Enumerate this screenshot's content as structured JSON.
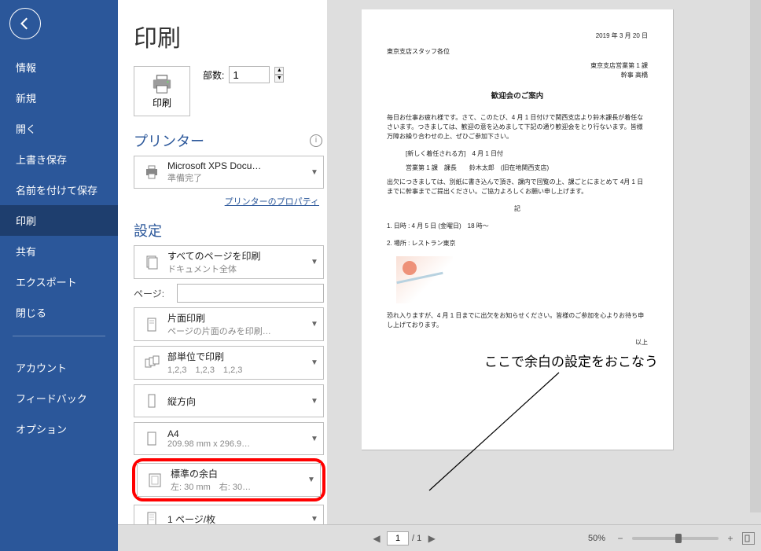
{
  "page_title": "印刷",
  "sidebar": {
    "items": [
      "情報",
      "新規",
      "開く",
      "上書き保存",
      "名前を付けて保存",
      "印刷",
      "共有",
      "エクスポート",
      "閉じる"
    ],
    "bottom_items": [
      "アカウント",
      "フィードバック",
      "オプション"
    ]
  },
  "print_button_label": "印刷",
  "copies": {
    "label": "部数:",
    "value": "1"
  },
  "printer": {
    "section_label": "プリンター",
    "name": "Microsoft XPS Docu…",
    "status": "準備完了",
    "properties_link": "プリンターのプロパティ"
  },
  "settings": {
    "section_label": "設定",
    "pages_label": "ページ:",
    "items": {
      "pages_all": {
        "title": "すべてのページを印刷",
        "sub": "ドキュメント全体"
      },
      "duplex": {
        "title": "片面印刷",
        "sub": "ページの片面のみを印刷…"
      },
      "collated": {
        "title": "部単位で印刷",
        "sub": "1,2,3　1,2,3　1,2,3"
      },
      "orient": {
        "title": "縦方向",
        "sub": ""
      },
      "papersize": {
        "title": "A4",
        "sub": "209.98 mm x 296.9…"
      },
      "margins": {
        "title": "標準の余白",
        "sub": "左: 30 mm　右: 30…"
      },
      "ppsheet": {
        "title": "1 ページ/枚",
        "sub": ""
      }
    }
  },
  "annotation_text": "ここで余白の設定をおこなう",
  "preview_footer": {
    "page_value": "1",
    "page_total": "/ 1",
    "zoom_percent": "50%"
  },
  "document": {
    "date": "2019 年 3 月 20 日",
    "to_line": "東京支店スタッフ各位",
    "from_line1": "東京支店営業第 1 課",
    "from_line2": "幹事 高橋",
    "title": "歓迎会のご案内",
    "para1": "毎日お仕事お疲れ様です。さて、このたび、4 月 1 日付けで関西支店より鈴木課長が着任なさいます。つきましては、歓迎の意を込めまして下記の通り歓迎会をとり行ないます。皆様万障お繰り合わせの上、ぜひご参加下さい。",
    "ki": "記",
    "note1": "[新しく着任される方]　4 月 1 日付",
    "note2": "営業第 1 課　課長　　鈴木太郎　(旧在地関西支店)",
    "para2": "出欠につきましては、別紙に書き込んで頂き、課内で回覧の上、課ごとにまとめて 4月 1 日までに幹事までご提出ください。ご協力よろしくお願い申し上げます。",
    "line_date": "1. 日時 : 4 月 5 日 (金曜日)　18 時～",
    "line_place": "2. 場所 : レストラン東京",
    "para3": "恐れ入りますが、4 月 1 日までに出欠をお知らせください。皆様のご参加を心よりお待ち申し上げております。",
    "closing": "以上"
  }
}
